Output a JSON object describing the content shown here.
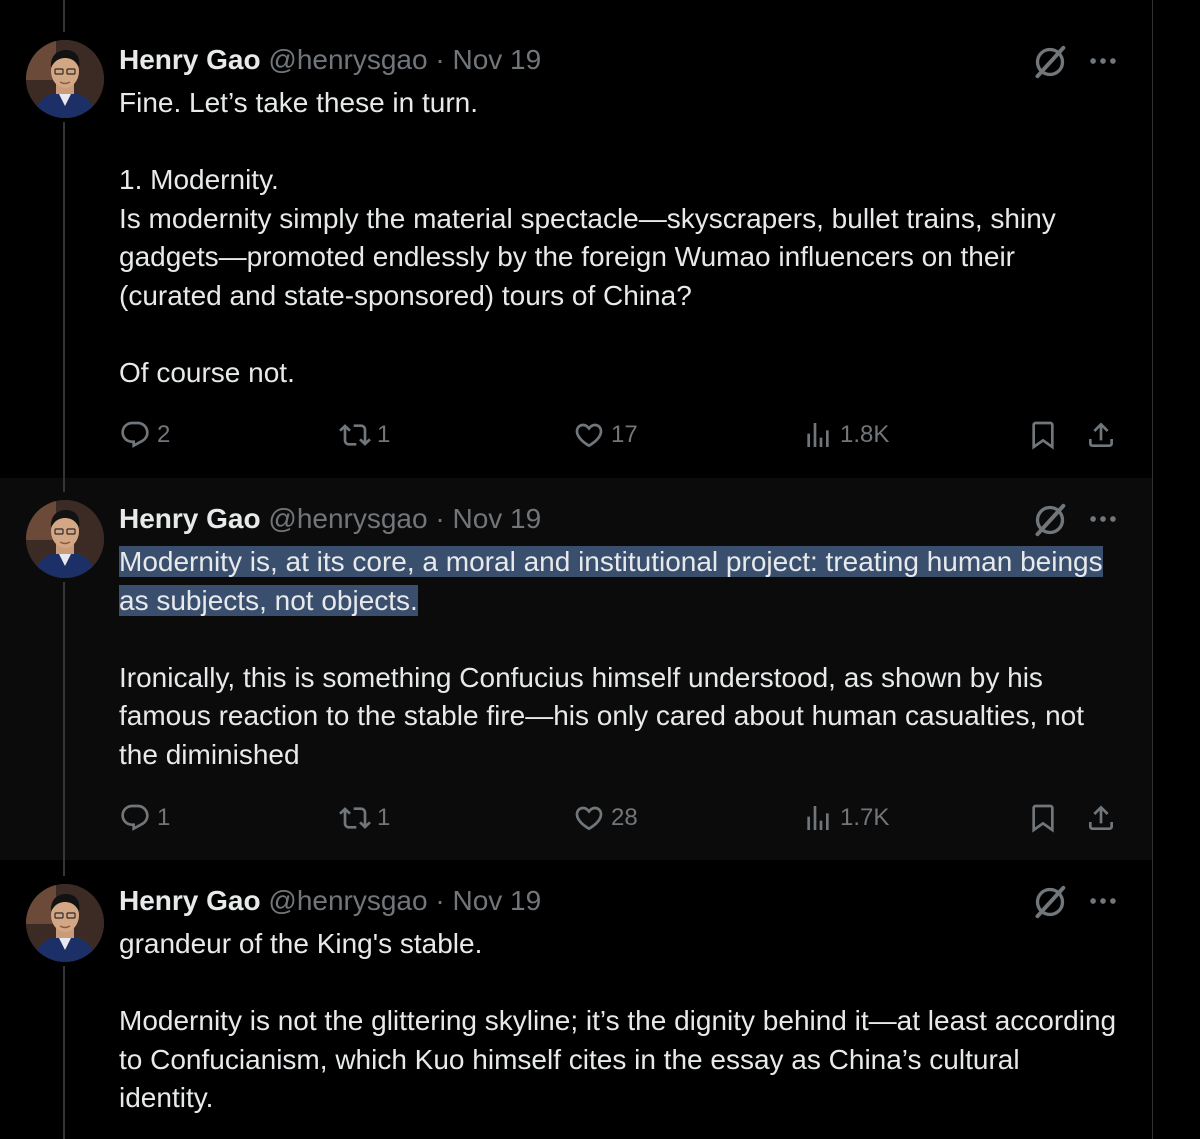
{
  "tweets": [
    {
      "author": {
        "name": "Henry Gao",
        "handle": "@henrysgao"
      },
      "separator": "·",
      "date": "Nov 19",
      "paragraphs": [
        "Fine. Let’s take these in turn.",
        "",
        "1. Modernity.",
        "Is modernity simply the material spectacle—skyscrapers, bullet trains, shiny gadgets—promoted endlessly by the foreign Wumao influencers on their (curated and state-sponsored) tours of China?",
        "",
        "Of course not."
      ],
      "stats": {
        "replies": "2",
        "reposts": "1",
        "likes": "17",
        "views": "1.8K"
      }
    },
    {
      "author": {
        "name": "Henry Gao",
        "handle": "@henrysgao"
      },
      "separator": "·",
      "date": "Nov 19",
      "highlighted_text": "Modernity is, at its core, a moral and institutional project: treating human beings as subjects, not objects.",
      "paragraphs": [
        "",
        "Ironically, this is something Confucius himself understood, as shown by his famous reaction to the stable fire—his only cared about human casualties, not the diminished"
      ],
      "stats": {
        "replies": "1",
        "reposts": "1",
        "likes": "28",
        "views": "1.7K"
      }
    },
    {
      "author": {
        "name": "Henry Gao",
        "handle": "@henrysgao"
      },
      "separator": "·",
      "date": "Nov 19",
      "paragraphs": [
        "grandeur of the King's stable.",
        "",
        "Modernity is not the glittering skyline; it’s the dignity behind it—at least according to Confucianism, which Kuo himself cites in the essay as China’s cultural identity."
      ]
    }
  ],
  "icons": {
    "reply": "reply-icon",
    "repost": "repost-icon",
    "like": "heart-icon",
    "views": "views-icon",
    "bookmark": "bookmark-icon",
    "share": "share-icon",
    "grok": "grok-icon",
    "more": "more-icon"
  },
  "colors": {
    "background": "#000000",
    "text": "#e7e9ea",
    "secondary": "#71767b",
    "selection": "#3a4f6e",
    "thread_line": "#333639"
  }
}
